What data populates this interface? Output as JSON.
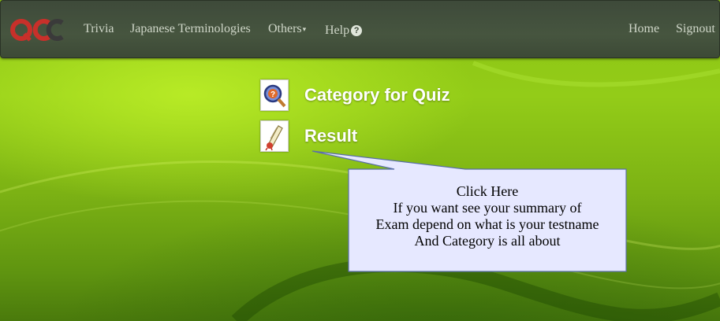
{
  "nav": {
    "logo_text": "QCC",
    "items": [
      {
        "label": "Trivia"
      },
      {
        "label": "Japanese Terminologies"
      },
      {
        "label": "Others"
      },
      {
        "label": "Help"
      }
    ],
    "right_items": [
      {
        "label": "Home"
      },
      {
        "label": "Signout"
      }
    ]
  },
  "menu": [
    {
      "label": "Category for Quiz",
      "icon": "magnifier-question-icon"
    },
    {
      "label": "Result",
      "icon": "diploma-icon"
    }
  ],
  "tooltip": {
    "line1": "Click Here",
    "line2": "If you want see your summary of",
    "line3": "Exam depend on what is your testname",
    "line4": "And Category is all about"
  },
  "colors": {
    "navbar": "#46553f",
    "background": "#8cc414",
    "tooltip_fill": "#e6e8ff",
    "tooltip_border": "#5a6fa8"
  }
}
